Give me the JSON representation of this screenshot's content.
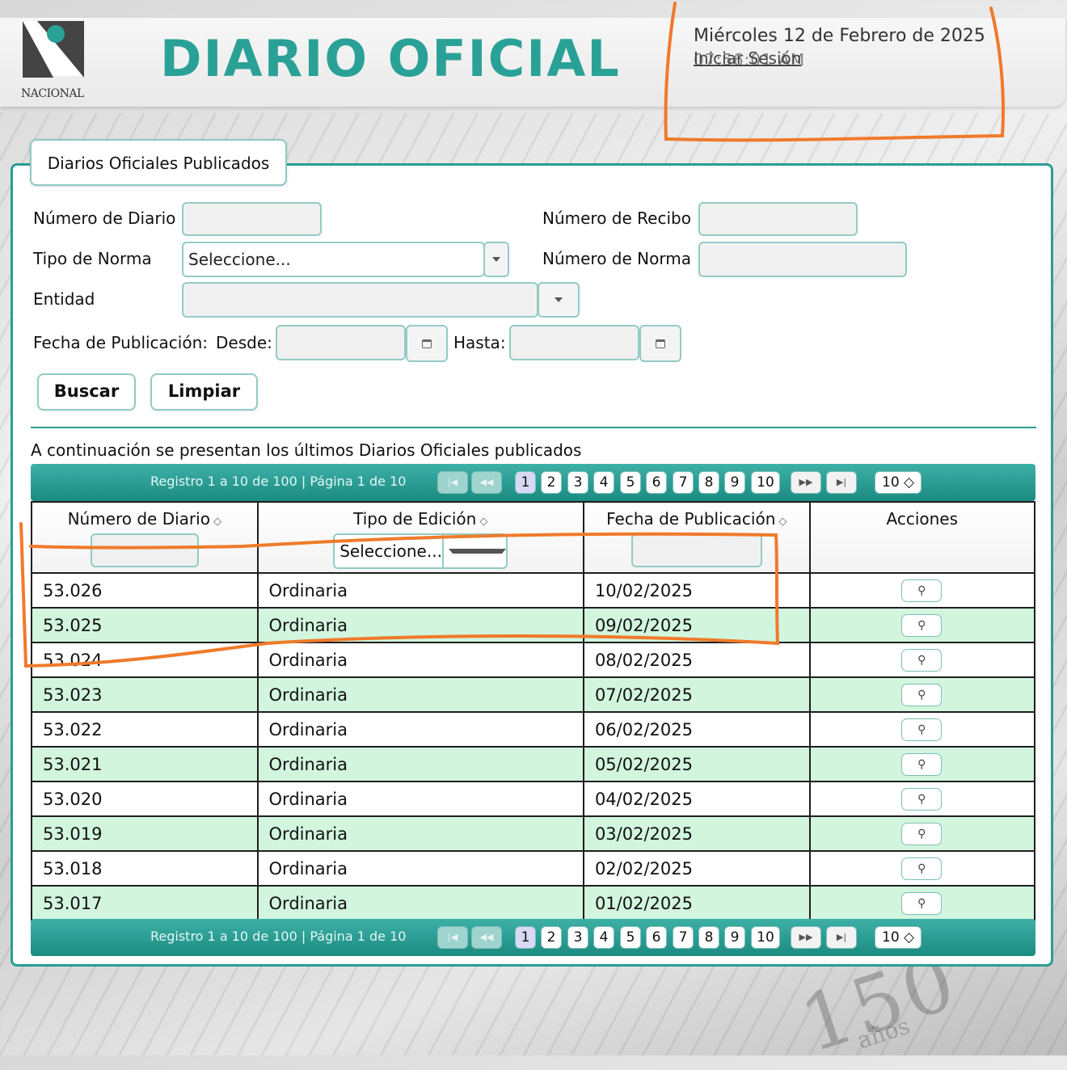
{
  "header": {
    "logo_text": "NACIONAL",
    "title": "DIARIO OFICIAL",
    "date": "Miércoles 12 de Febrero de 2025",
    "login": "Iniciar Sesión",
    "time": "07:56:01 AM"
  },
  "panel": {
    "tab_label": "Diarios Oficiales Publicados"
  },
  "form": {
    "numero_diario_label": "Número de Diario",
    "numero_diario_value": "",
    "numero_recibo_label": "Número de Recibo",
    "numero_recibo_value": "",
    "tipo_norma_label": "Tipo de Norma",
    "tipo_norma_value": "Seleccione...",
    "numero_norma_label": "Número de Norma",
    "numero_norma_value": "",
    "entidad_label": "Entidad",
    "entidad_value": "",
    "fecha_label": "Fecha de Publicación:",
    "desde_label": "Desde:",
    "desde_value": "",
    "hasta_label": "Hasta:",
    "hasta_value": "",
    "buscar_label": "Buscar",
    "limpiar_label": "Limpiar"
  },
  "intro_text": "A continuación se presentan los últimos Diarios Oficiales publicados",
  "pager": {
    "info": "Registro 1 a 10 de 100 | Página 1 de 10",
    "first": "|◀",
    "prev": "◀◀",
    "next": "▶▶",
    "last": "▶|",
    "pages": [
      "1",
      "2",
      "3",
      "4",
      "5",
      "6",
      "7",
      "8",
      "9",
      "10"
    ],
    "current_page": "1",
    "rows_per_page": "10 ◇"
  },
  "table": {
    "columns": [
      "Número de Diario",
      "Tipo de Edición",
      "Fecha de Publicación",
      "Acciones"
    ],
    "sort_icon": "◇",
    "tipo_filter_value": "Seleccione...",
    "rows": [
      {
        "numero": "53.026",
        "tipo": "Ordinaria",
        "fecha": "10/02/2025"
      },
      {
        "numero": "53.025",
        "tipo": "Ordinaria",
        "fecha": "09/02/2025"
      },
      {
        "numero": "53.024",
        "tipo": "Ordinaria",
        "fecha": "08/02/2025"
      },
      {
        "numero": "53.023",
        "tipo": "Ordinaria",
        "fecha": "07/02/2025"
      },
      {
        "numero": "53.022",
        "tipo": "Ordinaria",
        "fecha": "06/02/2025"
      },
      {
        "numero": "53.021",
        "tipo": "Ordinaria",
        "fecha": "05/02/2025"
      },
      {
        "numero": "53.020",
        "tipo": "Ordinaria",
        "fecha": "04/02/2025"
      },
      {
        "numero": "53.019",
        "tipo": "Ordinaria",
        "fecha": "03/02/2025"
      },
      {
        "numero": "53.018",
        "tipo": "Ordinaria",
        "fecha": "02/02/2025"
      },
      {
        "numero": "53.017",
        "tipo": "Ordinaria",
        "fecha": "01/02/2025"
      }
    ],
    "action_icon": "magnifier-icon"
  },
  "background": {
    "watermark_number": "150",
    "watermark_word": "años"
  },
  "colors": {
    "brand_teal": "#2aa197",
    "pager_teal": "#1c8b82",
    "row_alt": "#d2f5de",
    "annotation_orange": "#f07a2a"
  }
}
